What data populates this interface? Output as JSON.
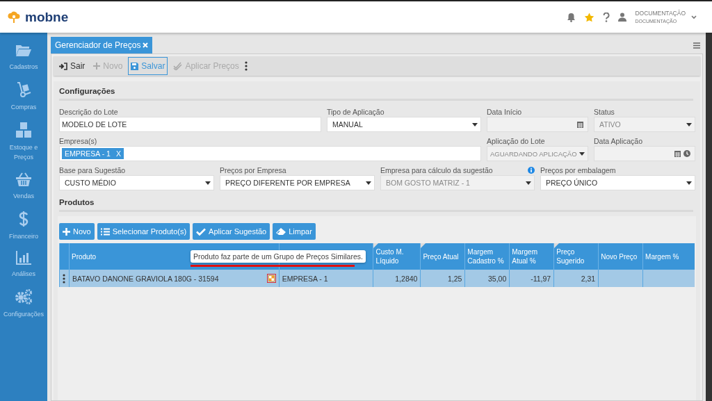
{
  "app": {
    "logo_text": "mobne",
    "user_name": "DOCUMENTAÇÃO",
    "user_subtitle": "DOCUMENTAÇÃO"
  },
  "sidebar": {
    "items": [
      {
        "label": "Cadastros",
        "kind": "folder"
      },
      {
        "label": "Compras",
        "kind": "dolly"
      },
      {
        "label": "Estoque e Preços",
        "kind": "boxes"
      },
      {
        "label": "Vendas",
        "kind": "basket"
      },
      {
        "label": "Financeiro",
        "kind": "dollar"
      },
      {
        "label": "Análises",
        "kind": "chart"
      },
      {
        "label": "Configurações",
        "kind": "gears"
      }
    ]
  },
  "tabs": [
    {
      "label": "Gerenciador de Preços",
      "selected": true
    }
  ],
  "toolbar": [
    {
      "label": "Sair",
      "kind": "exit",
      "disabled": false,
      "selected": false
    },
    {
      "label": "Novo",
      "kind": "plus",
      "disabled": true,
      "selected": false
    },
    {
      "label": "Salvar",
      "kind": "save",
      "disabled": false,
      "selected": true
    },
    {
      "label": "Aplicar Preços",
      "kind": "check",
      "disabled": true,
      "selected": false
    }
  ],
  "config": {
    "title": "Configurações",
    "rows": [
      [
        {
          "label": "Descrição do Lote",
          "value": "MODELO DE LOTE",
          "kind": "text",
          "disabled": false
        },
        {
          "label": "Tipo de Aplicação",
          "value": "MANUAL",
          "kind": "select",
          "disabled": false
        },
        {
          "label": "Data Início",
          "kind": "date",
          "disabled": true
        },
        {
          "label": "Status",
          "value": "ATIVO",
          "kind": "select",
          "disabled": true
        }
      ],
      [
        {
          "label": "Empresa(s)",
          "kind": "tags",
          "tags": [
            {
              "text": "EMPRESA - 1",
              "remove": "X"
            }
          ],
          "disabled": false
        },
        {
          "label": "Aplicação do Lote",
          "value": "AGUARDANDO APLICAÇÃO",
          "kind": "select",
          "disabled": true
        },
        {
          "label": "Data Aplicação",
          "kind": "datetime",
          "disabled": true
        }
      ],
      [
        {
          "label": "Base para Sugestão",
          "value": "CUSTO MÉDIO",
          "kind": "select",
          "disabled": false
        },
        {
          "label": "Preços por Empresa",
          "value": "PREÇO DIFERENTE POR EMPRESA",
          "kind": "select",
          "disabled": false
        },
        {
          "label": "Empresa para cálculo da sugestão",
          "value": "BOM GOSTO MATRIZ - 1",
          "kind": "select",
          "disabled": true,
          "info": true
        },
        {
          "label": "Preços por embalagem",
          "value": "PREÇO ÚNICO",
          "kind": "select",
          "disabled": false
        }
      ]
    ]
  },
  "products": {
    "title": "Produtos",
    "buttons": [
      {
        "label": "Novo",
        "kind": "plus"
      },
      {
        "label": "Selecionar Produto(s)",
        "kind": "list"
      },
      {
        "label": "Aplicar Sugestão",
        "kind": "check"
      },
      {
        "label": "Limpar",
        "kind": "eraser"
      }
    ],
    "table": {
      "columns": [
        {
          "label": "Produto",
          "flagged": false
        },
        {
          "flagged": false
        },
        {
          "label": "Custo M. Líquido",
          "flagged": true
        },
        {
          "label": "Preço Atual",
          "flagged": true
        },
        {
          "label": "Margem Cadastro %",
          "flagged": false
        },
        {
          "label": "Margem Atual %",
          "flagged": false
        },
        {
          "label": "Preço Sugerido",
          "flagged": true
        },
        {
          "label": "Novo Preço",
          "flagged": false
        },
        {
          "label": "Margem %",
          "flagged": false
        }
      ],
      "rows": [
        {
          "selected": true,
          "similar_group": true,
          "cells": [
            "BATAVO DANONE GRAVIOLA 180G - 31594",
            "EMPRESA - 1",
            "1,2840",
            "1,25",
            "35,00",
            "-11,97",
            "2,31",
            "",
            ""
          ]
        }
      ]
    },
    "tooltip": "Produto faz parte de um Grupo de Preços Similares."
  }
}
